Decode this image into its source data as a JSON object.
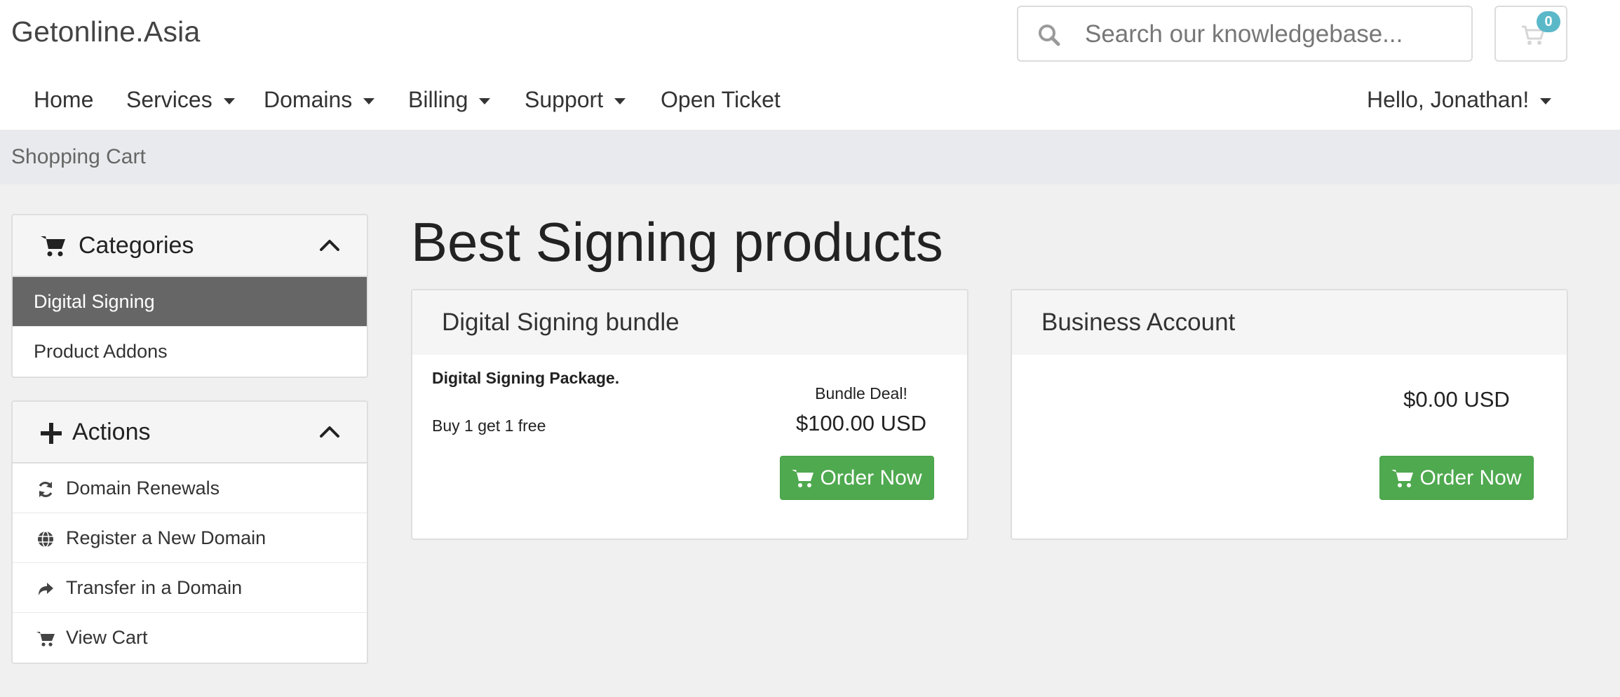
{
  "brand": "Getonline.Asia",
  "search": {
    "placeholder": "Search our knowledgebase..."
  },
  "cart": {
    "count": "0"
  },
  "nav": {
    "items": [
      {
        "label": "Home"
      },
      {
        "label": "Services"
      },
      {
        "label": "Domains"
      },
      {
        "label": "Billing"
      },
      {
        "label": "Support"
      },
      {
        "label": "Open Ticket"
      }
    ],
    "user": "Hello, Jonathan!"
  },
  "breadcrumb": "Shopping Cart",
  "sidebar": {
    "categories": {
      "title": "Categories",
      "items": [
        {
          "label": "Digital Signing",
          "active": true
        },
        {
          "label": "Product Addons",
          "active": false
        }
      ]
    },
    "actions": {
      "title": "Actions",
      "items": [
        {
          "label": "Domain Renewals",
          "icon": "refresh-icon"
        },
        {
          "label": "Register a New Domain",
          "icon": "globe-icon"
        },
        {
          "label": "Transfer in a Domain",
          "icon": "share-arrow-icon"
        },
        {
          "label": "View Cart",
          "icon": "cart-icon"
        }
      ]
    }
  },
  "main": {
    "title": "Best Signing products",
    "products": [
      {
        "name": "Digital Signing bundle",
        "description_title": "Digital Signing Package.",
        "description": "Buy 1 get 1 free",
        "deal": "Bundle Deal!",
        "price": "$100.00 USD",
        "button": "Order Now"
      },
      {
        "name": "Business Account",
        "price": "$0.00 USD",
        "button": "Order Now"
      }
    ]
  },
  "colors": {
    "accent_green": "#4fa94f",
    "active_item": "#666666",
    "badge": "#5bb8c9",
    "breadcrumb_bar": "#e9eaed"
  }
}
